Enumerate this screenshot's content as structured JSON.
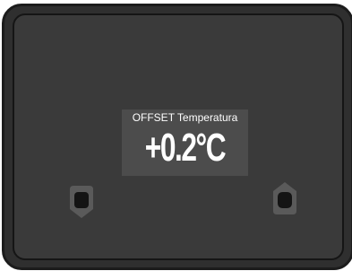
{
  "display": {
    "title": "OFFSET Temperatura",
    "value": "+0.2°C"
  },
  "buttons": {
    "down_icon": "chevron-down-icon",
    "up_icon": "chevron-up-icon"
  },
  "colors": {
    "body": "#2f2f2f",
    "panel": "#3a3a3a",
    "display_bg": "#4c4c4c",
    "display_text": "#ffffff"
  }
}
